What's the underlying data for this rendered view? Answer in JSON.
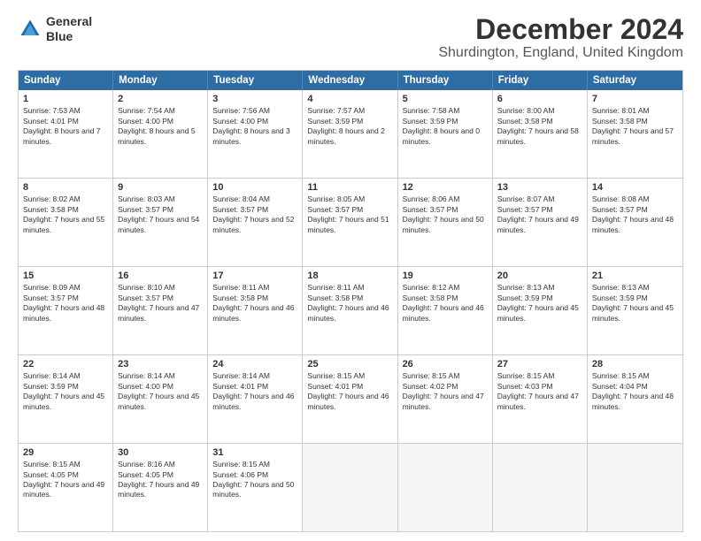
{
  "header": {
    "logo_line1": "General",
    "logo_line2": "Blue",
    "title": "December 2024",
    "subtitle": "Shurdington, England, United Kingdom"
  },
  "days": [
    "Sunday",
    "Monday",
    "Tuesday",
    "Wednesday",
    "Thursday",
    "Friday",
    "Saturday"
  ],
  "weeks": [
    [
      {
        "day": 1,
        "sunrise": "7:53 AM",
        "sunset": "4:01 PM",
        "daylight": "8 hours and 7 minutes."
      },
      {
        "day": 2,
        "sunrise": "7:54 AM",
        "sunset": "4:00 PM",
        "daylight": "8 hours and 5 minutes."
      },
      {
        "day": 3,
        "sunrise": "7:56 AM",
        "sunset": "4:00 PM",
        "daylight": "8 hours and 3 minutes."
      },
      {
        "day": 4,
        "sunrise": "7:57 AM",
        "sunset": "3:59 PM",
        "daylight": "8 hours and 2 minutes."
      },
      {
        "day": 5,
        "sunrise": "7:58 AM",
        "sunset": "3:59 PM",
        "daylight": "8 hours and 0 minutes."
      },
      {
        "day": 6,
        "sunrise": "8:00 AM",
        "sunset": "3:58 PM",
        "daylight": "7 hours and 58 minutes."
      },
      {
        "day": 7,
        "sunrise": "8:01 AM",
        "sunset": "3:58 PM",
        "daylight": "7 hours and 57 minutes."
      }
    ],
    [
      {
        "day": 8,
        "sunrise": "8:02 AM",
        "sunset": "3:58 PM",
        "daylight": "7 hours and 55 minutes."
      },
      {
        "day": 9,
        "sunrise": "8:03 AM",
        "sunset": "3:57 PM",
        "daylight": "7 hours and 54 minutes."
      },
      {
        "day": 10,
        "sunrise": "8:04 AM",
        "sunset": "3:57 PM",
        "daylight": "7 hours and 52 minutes."
      },
      {
        "day": 11,
        "sunrise": "8:05 AM",
        "sunset": "3:57 PM",
        "daylight": "7 hours and 51 minutes."
      },
      {
        "day": 12,
        "sunrise": "8:06 AM",
        "sunset": "3:57 PM",
        "daylight": "7 hours and 50 minutes."
      },
      {
        "day": 13,
        "sunrise": "8:07 AM",
        "sunset": "3:57 PM",
        "daylight": "7 hours and 49 minutes."
      },
      {
        "day": 14,
        "sunrise": "8:08 AM",
        "sunset": "3:57 PM",
        "daylight": "7 hours and 48 minutes."
      }
    ],
    [
      {
        "day": 15,
        "sunrise": "8:09 AM",
        "sunset": "3:57 PM",
        "daylight": "7 hours and 48 minutes."
      },
      {
        "day": 16,
        "sunrise": "8:10 AM",
        "sunset": "3:57 PM",
        "daylight": "7 hours and 47 minutes."
      },
      {
        "day": 17,
        "sunrise": "8:11 AM",
        "sunset": "3:58 PM",
        "daylight": "7 hours and 46 minutes."
      },
      {
        "day": 18,
        "sunrise": "8:11 AM",
        "sunset": "3:58 PM",
        "daylight": "7 hours and 46 minutes."
      },
      {
        "day": 19,
        "sunrise": "8:12 AM",
        "sunset": "3:58 PM",
        "daylight": "7 hours and 46 minutes."
      },
      {
        "day": 20,
        "sunrise": "8:13 AM",
        "sunset": "3:59 PM",
        "daylight": "7 hours and 45 minutes."
      },
      {
        "day": 21,
        "sunrise": "8:13 AM",
        "sunset": "3:59 PM",
        "daylight": "7 hours and 45 minutes."
      }
    ],
    [
      {
        "day": 22,
        "sunrise": "8:14 AM",
        "sunset": "3:59 PM",
        "daylight": "7 hours and 45 minutes."
      },
      {
        "day": 23,
        "sunrise": "8:14 AM",
        "sunset": "4:00 PM",
        "daylight": "7 hours and 45 minutes."
      },
      {
        "day": 24,
        "sunrise": "8:14 AM",
        "sunset": "4:01 PM",
        "daylight": "7 hours and 46 minutes."
      },
      {
        "day": 25,
        "sunrise": "8:15 AM",
        "sunset": "4:01 PM",
        "daylight": "7 hours and 46 minutes."
      },
      {
        "day": 26,
        "sunrise": "8:15 AM",
        "sunset": "4:02 PM",
        "daylight": "7 hours and 47 minutes."
      },
      {
        "day": 27,
        "sunrise": "8:15 AM",
        "sunset": "4:03 PM",
        "daylight": "7 hours and 47 minutes."
      },
      {
        "day": 28,
        "sunrise": "8:15 AM",
        "sunset": "4:04 PM",
        "daylight": "7 hours and 48 minutes."
      }
    ],
    [
      {
        "day": 29,
        "sunrise": "8:15 AM",
        "sunset": "4:05 PM",
        "daylight": "7 hours and 49 minutes."
      },
      {
        "day": 30,
        "sunrise": "8:16 AM",
        "sunset": "4:05 PM",
        "daylight": "7 hours and 49 minutes."
      },
      {
        "day": 31,
        "sunrise": "8:15 AM",
        "sunset": "4:06 PM",
        "daylight": "7 hours and 50 minutes."
      },
      null,
      null,
      null,
      null
    ]
  ]
}
